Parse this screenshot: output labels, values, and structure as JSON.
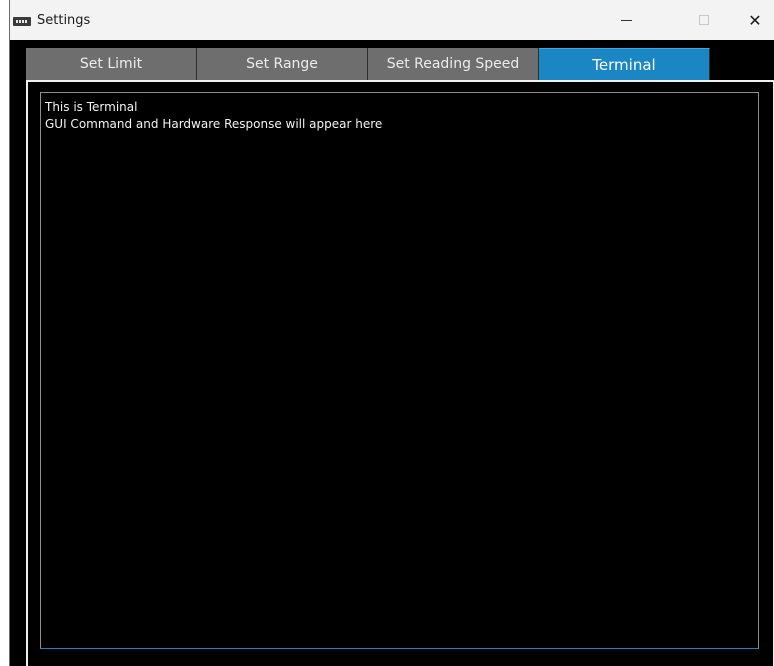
{
  "window": {
    "title": "Settings",
    "controls": {
      "minimize": "—",
      "maximize": "□",
      "close": "✕"
    }
  },
  "tabs": [
    {
      "label": "Set Limit",
      "active": false
    },
    {
      "label": "Set Range",
      "active": false
    },
    {
      "label": "Set Reading Speed",
      "active": false
    },
    {
      "label": "Terminal",
      "active": true
    }
  ],
  "terminal": {
    "lines": [
      "This is Terminal",
      "GUI Command and Hardware Response will appear here"
    ]
  },
  "colors": {
    "active_tab": "#1a86c3",
    "inactive_tab": "#6e6e6e",
    "background": "#000000",
    "text": "#f2f2f2"
  }
}
